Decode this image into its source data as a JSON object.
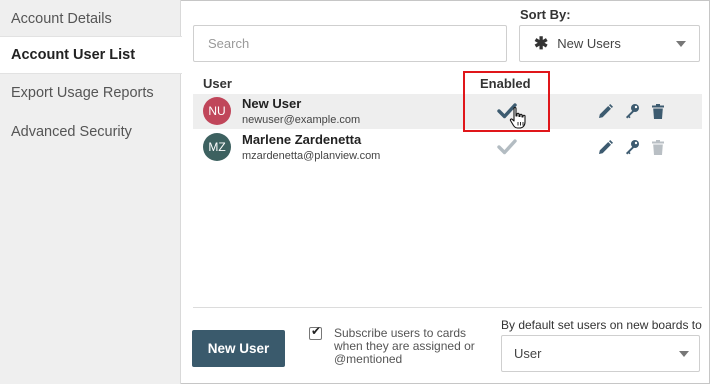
{
  "sidebar": {
    "items": [
      {
        "label": "Account Details",
        "active": false
      },
      {
        "label": "Account User List",
        "active": true
      },
      {
        "label": "Export Usage Reports",
        "active": false
      },
      {
        "label": "Advanced Security",
        "active": false
      }
    ]
  },
  "sort": {
    "label": "Sort By:",
    "value": "New Users",
    "icon": "asterisk-icon"
  },
  "search": {
    "placeholder": "Search",
    "value": ""
  },
  "table": {
    "headers": {
      "user": "User",
      "enabled": "Enabled"
    },
    "rows": [
      {
        "initials": "NU",
        "avatar_color": "#c0465a",
        "name": "New User",
        "email": "newuser@example.com",
        "enabled": true,
        "check_color": "#3d5b70",
        "delete_enabled": true
      },
      {
        "initials": "MZ",
        "avatar_color": "#3d6160",
        "name": "Marlene Zardenetta",
        "email": "mzardenetta@planview.com",
        "enabled": true,
        "check_color": "#b3bcc2",
        "delete_enabled": false
      }
    ]
  },
  "footer": {
    "new_user_label": "New User",
    "subscribe_checked": true,
    "subscribe_text": "Subscribe users to cards when they are assigned or @mentioned",
    "default_label": "By default set users on new boards to",
    "default_value": "User"
  },
  "colors": {
    "accent": "#3a5a6c",
    "highlight_box": "#e0161a",
    "icon": "#3d5b70",
    "icon_disabled": "#b9bfc4"
  }
}
